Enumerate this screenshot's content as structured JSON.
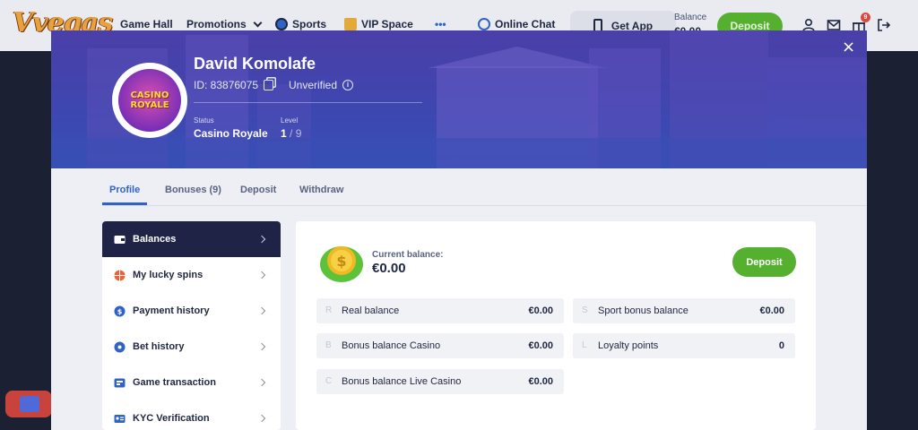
{
  "nav": {
    "logo": "Vvegas",
    "items": [
      {
        "label": "Game Hall"
      },
      {
        "label": "Promotions"
      },
      {
        "label": "Sports"
      },
      {
        "label": "VIP Space"
      },
      {
        "label": "•••"
      },
      {
        "label": "Online Chat"
      }
    ],
    "get_app": "Get App",
    "balance_label": "Balance",
    "balance_value": "€0.00",
    "deposit": "Deposit",
    "notification_count": "9"
  },
  "profile": {
    "name": "David Komolafe",
    "id": "ID: 83876075",
    "verification": "Unverified",
    "status_label": "Status",
    "status_value": "Casino Royale",
    "level_label": "Level",
    "level_current": "1",
    "level_sep": "/",
    "level_total": "9",
    "avatar_text_1": "CASINO",
    "avatar_text_2": "ROYALE"
  },
  "tabs": [
    {
      "label": "Profile",
      "active": true
    },
    {
      "label": "Bonuses (9)"
    },
    {
      "label": "Deposit"
    },
    {
      "label": "Withdraw"
    }
  ],
  "menu": [
    {
      "label": "Balances",
      "icon": "wallet-icon",
      "active": true
    },
    {
      "label": "My lucky spins",
      "icon": "lucky-spin-icon"
    },
    {
      "label": "Payment history",
      "icon": "dollar-icon"
    },
    {
      "label": "Bet history",
      "icon": "soccer-ball-icon"
    },
    {
      "label": "Game transaction",
      "icon": "card-icon"
    },
    {
      "label": "KYC Verification",
      "icon": "id-card-icon"
    }
  ],
  "balances": {
    "current_label": "Current balance:",
    "current_value": "€0.00",
    "deposit": "Deposit",
    "rows": [
      {
        "letter": "R",
        "name": "Real balance",
        "amount": "€0.00"
      },
      {
        "letter": "S",
        "name": "Sport bonus balance",
        "amount": "€0.00"
      },
      {
        "letter": "B",
        "name": "Bonus balance Casino",
        "amount": "€0.00"
      },
      {
        "letter": "L",
        "name": "Loyalty points",
        "amount": "0"
      },
      {
        "letter": "C",
        "name": "Bonus balance Live Casino",
        "amount": "€0.00"
      }
    ]
  },
  "colors": {
    "accent_green": "#55b02f",
    "accent_blue": "#2f63c8",
    "dark_navy": "#1f2446"
  }
}
